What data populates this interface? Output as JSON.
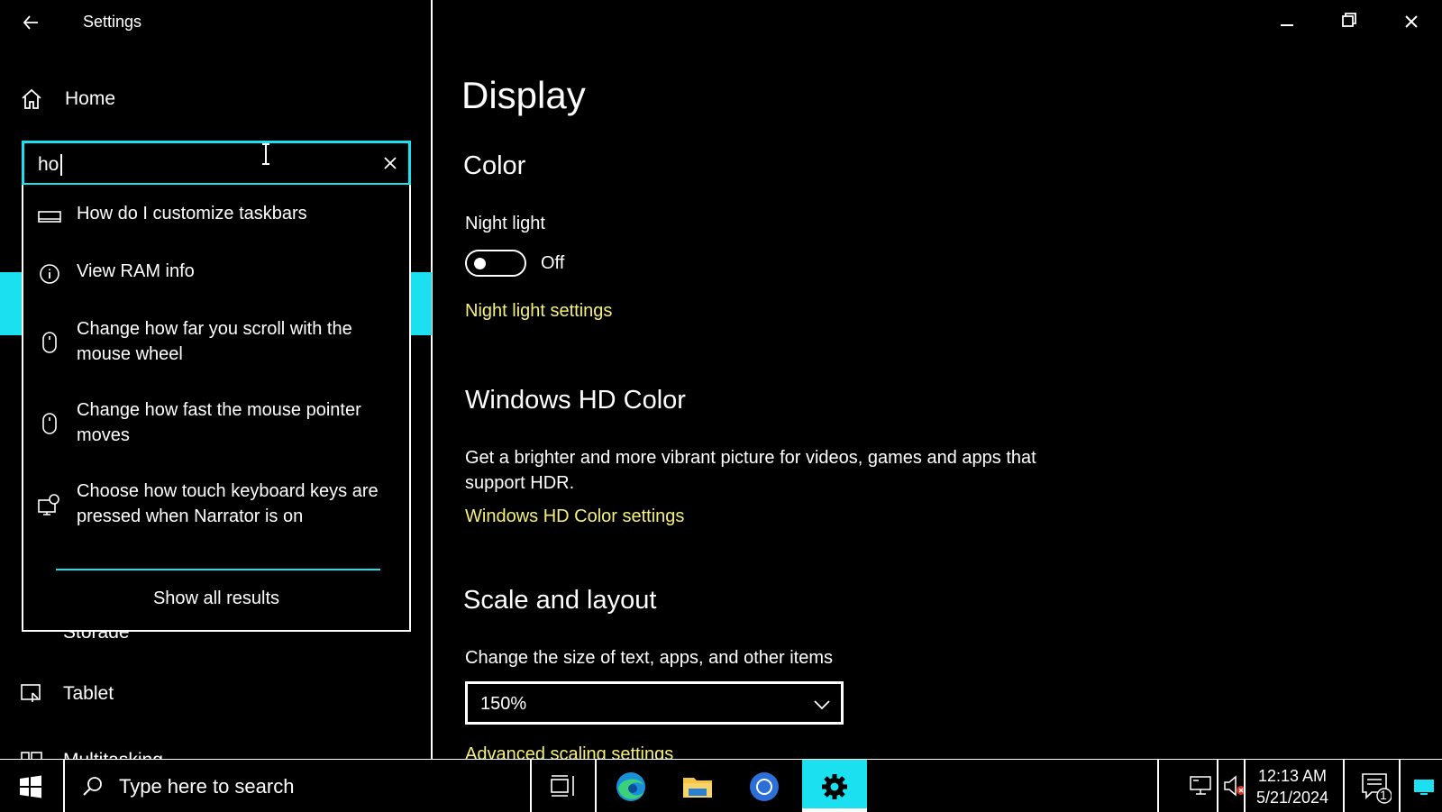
{
  "window": {
    "title": "Settings"
  },
  "sidebar": {
    "home_label": "Home",
    "storage_label": "Storage",
    "tablet_label": "Tablet",
    "multitasking_label": "Multitasking"
  },
  "search": {
    "value": "ho",
    "suggestions": [
      {
        "text": "How do I customize taskbars",
        "icon": "taskbar-icon"
      },
      {
        "text": "View RAM info",
        "icon": "info-icon"
      },
      {
        "text": "Change how far you scroll with the mouse wheel",
        "icon": "mouse-icon"
      },
      {
        "text": "Change how fast the mouse pointer moves",
        "icon": "mouse-icon"
      },
      {
        "text": "Choose how touch keyboard keys are pressed when Narrator is on",
        "icon": "narrator-icon"
      }
    ],
    "show_all_label": "Show all results"
  },
  "main": {
    "page_title": "Display",
    "color_heading": "Color",
    "night_light_label": "Night light",
    "night_light_state": "Off",
    "night_light_link": "Night light settings",
    "hd_color_heading": "Windows HD Color",
    "hd_color_desc": "Get a brighter and more vibrant picture for videos, games and apps that support HDR.",
    "hd_color_link": "Windows HD Color settings",
    "scale_heading": "Scale and layout",
    "scale_label": "Change the size of text, apps, and other items",
    "scale_value": "150%",
    "advanced_link": "Advanced scaling settings"
  },
  "taskbar": {
    "search_placeholder": "Type here to search",
    "time": "12:13 AM",
    "date": "5/21/2024",
    "notification_count": "1"
  },
  "colors": {
    "accent": "#1ae0f0",
    "link": "#f5f07a",
    "background": "#000000",
    "text": "#ffffff"
  }
}
